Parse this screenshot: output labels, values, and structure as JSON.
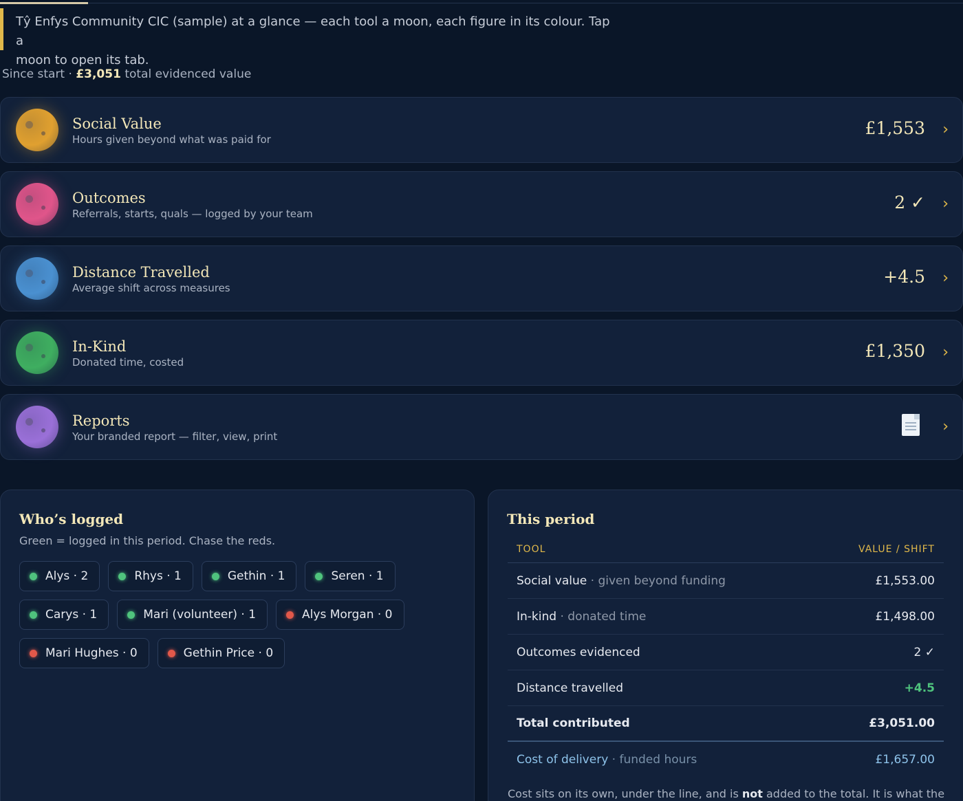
{
  "intro": {
    "line1": "Tŷ Enfys Community CIC (sample) at a glance — each tool a moon, each figure in its colour. Tap a",
    "line2": "moon to open its tab."
  },
  "summary": {
    "prefix": "Since start · ",
    "total": "£3,051",
    "suffix": " total evidenced value"
  },
  "tools": [
    {
      "title": "Social Value",
      "subtitle": "Hours given beyond what was paid for",
      "value": "£1,553",
      "color": "#e0a030"
    },
    {
      "title": "Outcomes",
      "subtitle": "Referrals, starts, quals — logged by your team",
      "value": "2 ✓",
      "color": "#e0558a"
    },
    {
      "title": "Distance Travelled",
      "subtitle": "Average shift across measures",
      "value": "+4.5",
      "color": "#4a90d0"
    },
    {
      "title": "In-Kind",
      "subtitle": "Donated time, costed",
      "value": "£1,350",
      "color": "#3fae60"
    },
    {
      "title": "Reports",
      "subtitle": "Your branded report — filter, view, print",
      "value": "",
      "icon": "document-icon",
      "color": "#9a70d8"
    }
  ],
  "whos_logged": {
    "title": "Who’s logged",
    "note": "Green = logged in this period. Chase the reds.",
    "people": [
      {
        "label": "Alys · 2",
        "status": "green"
      },
      {
        "label": "Rhys · 1",
        "status": "green"
      },
      {
        "label": "Gethin · 1",
        "status": "green"
      },
      {
        "label": "Seren · 1",
        "status": "green"
      },
      {
        "label": "Carys · 1",
        "status": "green"
      },
      {
        "label": "Mari (volunteer) · 1",
        "status": "green"
      },
      {
        "label": "Alys Morgan · 0",
        "status": "red"
      },
      {
        "label": "Mari Hughes · 0",
        "status": "red"
      },
      {
        "label": "Gethin Price · 0",
        "status": "red"
      }
    ]
  },
  "this_period": {
    "title": "This period",
    "col_tool": "TOOL",
    "col_value": "VALUE / SHIFT",
    "rows": [
      {
        "name": "Social value",
        "detail": " · given beyond funding",
        "value": "£1,553.00"
      },
      {
        "name": "In-kind",
        "detail": " · donated time",
        "value": "£1,498.00"
      },
      {
        "name": "Outcomes evidenced",
        "detail": "",
        "value": "2 ✓"
      },
      {
        "name": "Distance travelled",
        "detail": "",
        "value": "+4.5"
      }
    ],
    "total": {
      "name": "Total contributed",
      "value": "£3,051.00"
    },
    "cost": {
      "name": "Cost of delivery",
      "detail": " · funded hours",
      "value": "£1,657.00"
    },
    "footnote_a": "Cost sits on its own, under the line, and is ",
    "footnote_b": "not",
    "footnote_c": " added to the total. It is what the"
  },
  "colors": {
    "green": "#4fc37d",
    "red": "#e2584a",
    "accent": "#e0b84a",
    "heading": "#f3e7b8"
  }
}
